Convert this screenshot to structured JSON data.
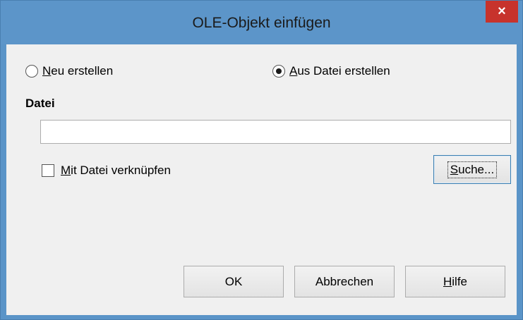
{
  "window": {
    "title": "OLE-Objekt einfügen",
    "close_symbol": "×"
  },
  "mode": {
    "options": [
      {
        "pre": "",
        "mnemonic": "N",
        "rest": "eu erstellen",
        "checked": false
      },
      {
        "pre": "",
        "mnemonic": "A",
        "rest": "us Datei erstellen",
        "checked": true
      }
    ]
  },
  "file": {
    "section_label": "Datei",
    "path_value": "",
    "link_checkbox": {
      "mnemonic": "M",
      "rest": "it Datei verknüpfen",
      "checked": false
    },
    "browse_button": {
      "mnemonic": "S",
      "rest": "uche..."
    }
  },
  "buttons": {
    "ok": "OK",
    "cancel": "Abbrechen",
    "help": {
      "mnemonic": "H",
      "rest": "ilfe"
    }
  },
  "colors": {
    "title_bar": "#5c95c9",
    "close_button": "#c7332c",
    "dialog_background": "#f0f0f0",
    "focus_border": "#3c7fb1"
  }
}
